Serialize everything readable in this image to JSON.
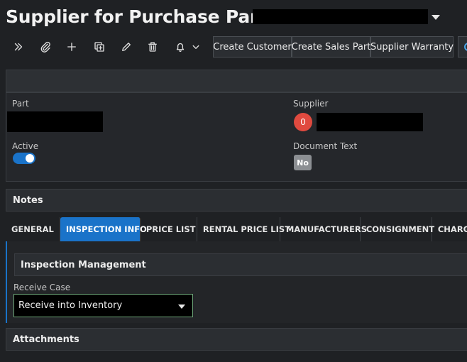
{
  "header": {
    "title": "Supplier for Purchase Part"
  },
  "toolbar": {
    "icons": [
      "double-chevron-right-icon",
      "paperclip-icon",
      "plus-icon",
      "duplicate-icon",
      "pencil-icon",
      "trash-icon",
      "bell-icon",
      "chevron-down-icon"
    ],
    "buttons": {
      "create_customer": "Create Customer",
      "create_sales_part": "Create Sales Part",
      "supplier_warranty": "Supplier Warranty"
    }
  },
  "form": {
    "part_label": "Part",
    "supplier_label": "Supplier",
    "supplier_badge": "0",
    "active_label": "Active",
    "active_value": true,
    "document_text_label": "Document Text",
    "document_text_value": "No"
  },
  "notes": {
    "title": "Notes"
  },
  "tabs": [
    {
      "label": "GENERAL",
      "active": false
    },
    {
      "label": "INSPECTION INFO",
      "active": true
    },
    {
      "label": "PRICE LIST",
      "active": false
    },
    {
      "label": "RENTAL PRICE LIST",
      "active": false
    },
    {
      "label": "MANUFACTURERS",
      "active": false
    },
    {
      "label": "CONSIGNMENT",
      "active": false
    },
    {
      "label": "CHARG",
      "active": false
    }
  ],
  "inspection": {
    "title": "Inspection Management",
    "receive_case_label": "Receive Case",
    "receive_case_value": "Receive into Inventory"
  },
  "attachments": {
    "title": "Attachments"
  },
  "colors": {
    "accent": "#1a73c9",
    "badge_red": "#e04a3f",
    "background": "#1f2124"
  }
}
